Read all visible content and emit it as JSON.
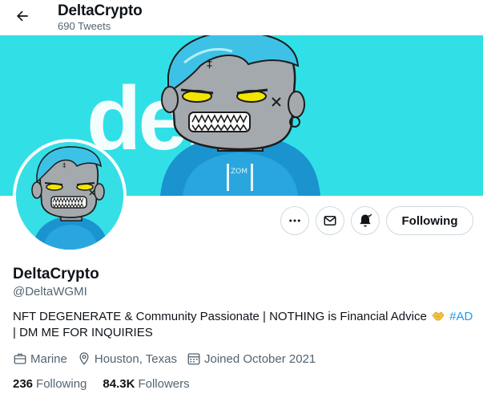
{
  "header": {
    "back_icon": "arrow-left-icon",
    "name": "DeltaCrypto",
    "tweet_count": "690 Tweets"
  },
  "banner": {
    "text": "delta",
    "background_color": "#31e0e6"
  },
  "actions": {
    "more_icon": "ellipsis-icon",
    "message_icon": "envelope-icon",
    "notify_icon": "bell-check-icon",
    "following_label": "Following"
  },
  "profile": {
    "name": "DeltaCrypto",
    "handle": "@DeltaWGMI",
    "bio_part1": "NFT DEGENERATE & Community Passionate | NOTHING is Financial Advice",
    "bio_emoji": "handshake-icon",
    "bio_hashtag": "#AD",
    "bio_part2": "| DM ME FOR INQUIRIES",
    "accent_color": "#1d9bf0"
  },
  "meta": {
    "category": "Marine",
    "location": "Houston, Texas",
    "joined": "Joined October 2021"
  },
  "stats": {
    "following_count": "236",
    "following_label": "Following",
    "followers_count": "84.3K",
    "followers_label": "Followers"
  }
}
